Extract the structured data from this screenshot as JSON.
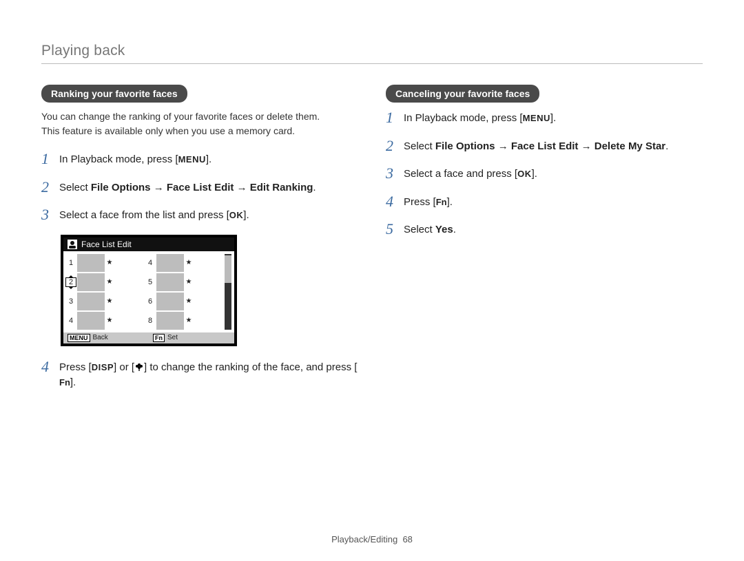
{
  "header": {
    "title": "Playing back"
  },
  "left": {
    "pill": "Ranking your favorite faces",
    "intro_l1": "You can change the ranking of your favorite faces or delete them.",
    "intro_l2": "This feature is available only when you use a memory card.",
    "steps": {
      "s1_pre": "In Playback mode, press [",
      "s1_key": "MENU",
      "s1_post": "].",
      "s2_pre": "Select ",
      "s2_b1": "File Options",
      "s2_arrow1": " → ",
      "s2_b2": "Face List Edit",
      "s2_arrow2": " → ",
      "s2_b3": "Edit Ranking",
      "s2_post": ".",
      "s3_pre": "Select a face from the list and press [",
      "s3_key": "OK",
      "s3_post": "].",
      "s4_pre": "Press [",
      "s4_key1": "DISP",
      "s4_mid1": "] or [",
      "s4_mid2": "] to change the ranking of the face, and press [",
      "s4_key2": "Fn",
      "s4_post": "]."
    },
    "screen": {
      "title": "Face List Edit",
      "left_ranks": [
        "1",
        "2",
        "3",
        "4"
      ],
      "right_ranks": [
        "4",
        "5",
        "6",
        "8"
      ],
      "footer_back_key": "MENU",
      "footer_back_label": "Back",
      "footer_set_key": "Fn",
      "footer_set_label": "Set"
    }
  },
  "right": {
    "pill": "Canceling your favorite faces",
    "steps": {
      "s1_pre": "In Playback mode, press [",
      "s1_key": "MENU",
      "s1_post": "].",
      "s2_pre": "Select ",
      "s2_b1": "File Options",
      "s2_arrow1": " → ",
      "s2_b2": "Face List Edit",
      "s2_arrow2": " → ",
      "s2_b3": "Delete My Star",
      "s2_post": ".",
      "s3_pre": "Select a face and press [",
      "s3_key": "OK",
      "s3_post": "].",
      "s4_pre": "Press [",
      "s4_key": "Fn",
      "s4_post": "].",
      "s5_pre": "Select ",
      "s5_b1": "Yes",
      "s5_post": "."
    }
  },
  "footer": {
    "section": "Playback/Editing",
    "page": "68"
  }
}
